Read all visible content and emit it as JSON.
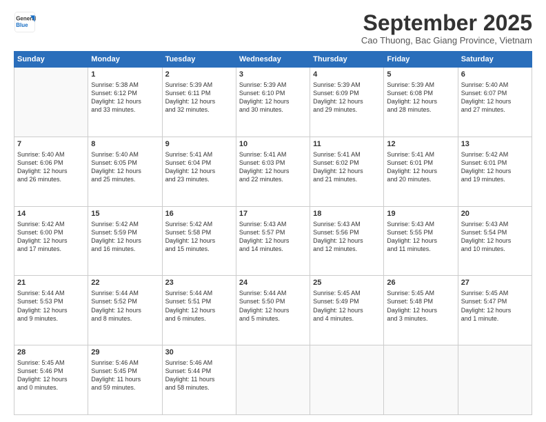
{
  "header": {
    "logo_line1": "General",
    "logo_line2": "Blue",
    "month_title": "September 2025",
    "subtitle": "Cao Thuong, Bac Giang Province, Vietnam"
  },
  "weekdays": [
    "Sunday",
    "Monday",
    "Tuesday",
    "Wednesday",
    "Thursday",
    "Friday",
    "Saturday"
  ],
  "weeks": [
    [
      {
        "day": "",
        "info": ""
      },
      {
        "day": "1",
        "info": "Sunrise: 5:38 AM\nSunset: 6:12 PM\nDaylight: 12 hours\nand 33 minutes."
      },
      {
        "day": "2",
        "info": "Sunrise: 5:39 AM\nSunset: 6:11 PM\nDaylight: 12 hours\nand 32 minutes."
      },
      {
        "day": "3",
        "info": "Sunrise: 5:39 AM\nSunset: 6:10 PM\nDaylight: 12 hours\nand 30 minutes."
      },
      {
        "day": "4",
        "info": "Sunrise: 5:39 AM\nSunset: 6:09 PM\nDaylight: 12 hours\nand 29 minutes."
      },
      {
        "day": "5",
        "info": "Sunrise: 5:39 AM\nSunset: 6:08 PM\nDaylight: 12 hours\nand 28 minutes."
      },
      {
        "day": "6",
        "info": "Sunrise: 5:40 AM\nSunset: 6:07 PM\nDaylight: 12 hours\nand 27 minutes."
      }
    ],
    [
      {
        "day": "7",
        "info": "Sunrise: 5:40 AM\nSunset: 6:06 PM\nDaylight: 12 hours\nand 26 minutes."
      },
      {
        "day": "8",
        "info": "Sunrise: 5:40 AM\nSunset: 6:05 PM\nDaylight: 12 hours\nand 25 minutes."
      },
      {
        "day": "9",
        "info": "Sunrise: 5:41 AM\nSunset: 6:04 PM\nDaylight: 12 hours\nand 23 minutes."
      },
      {
        "day": "10",
        "info": "Sunrise: 5:41 AM\nSunset: 6:03 PM\nDaylight: 12 hours\nand 22 minutes."
      },
      {
        "day": "11",
        "info": "Sunrise: 5:41 AM\nSunset: 6:02 PM\nDaylight: 12 hours\nand 21 minutes."
      },
      {
        "day": "12",
        "info": "Sunrise: 5:41 AM\nSunset: 6:01 PM\nDaylight: 12 hours\nand 20 minutes."
      },
      {
        "day": "13",
        "info": "Sunrise: 5:42 AM\nSunset: 6:01 PM\nDaylight: 12 hours\nand 19 minutes."
      }
    ],
    [
      {
        "day": "14",
        "info": "Sunrise: 5:42 AM\nSunset: 6:00 PM\nDaylight: 12 hours\nand 17 minutes."
      },
      {
        "day": "15",
        "info": "Sunrise: 5:42 AM\nSunset: 5:59 PM\nDaylight: 12 hours\nand 16 minutes."
      },
      {
        "day": "16",
        "info": "Sunrise: 5:42 AM\nSunset: 5:58 PM\nDaylight: 12 hours\nand 15 minutes."
      },
      {
        "day": "17",
        "info": "Sunrise: 5:43 AM\nSunset: 5:57 PM\nDaylight: 12 hours\nand 14 minutes."
      },
      {
        "day": "18",
        "info": "Sunrise: 5:43 AM\nSunset: 5:56 PM\nDaylight: 12 hours\nand 12 minutes."
      },
      {
        "day": "19",
        "info": "Sunrise: 5:43 AM\nSunset: 5:55 PM\nDaylight: 12 hours\nand 11 minutes."
      },
      {
        "day": "20",
        "info": "Sunrise: 5:43 AM\nSunset: 5:54 PM\nDaylight: 12 hours\nand 10 minutes."
      }
    ],
    [
      {
        "day": "21",
        "info": "Sunrise: 5:44 AM\nSunset: 5:53 PM\nDaylight: 12 hours\nand 9 minutes."
      },
      {
        "day": "22",
        "info": "Sunrise: 5:44 AM\nSunset: 5:52 PM\nDaylight: 12 hours\nand 8 minutes."
      },
      {
        "day": "23",
        "info": "Sunrise: 5:44 AM\nSunset: 5:51 PM\nDaylight: 12 hours\nand 6 minutes."
      },
      {
        "day": "24",
        "info": "Sunrise: 5:44 AM\nSunset: 5:50 PM\nDaylight: 12 hours\nand 5 minutes."
      },
      {
        "day": "25",
        "info": "Sunrise: 5:45 AM\nSunset: 5:49 PM\nDaylight: 12 hours\nand 4 minutes."
      },
      {
        "day": "26",
        "info": "Sunrise: 5:45 AM\nSunset: 5:48 PM\nDaylight: 12 hours\nand 3 minutes."
      },
      {
        "day": "27",
        "info": "Sunrise: 5:45 AM\nSunset: 5:47 PM\nDaylight: 12 hours\nand 1 minute."
      }
    ],
    [
      {
        "day": "28",
        "info": "Sunrise: 5:45 AM\nSunset: 5:46 PM\nDaylight: 12 hours\nand 0 minutes."
      },
      {
        "day": "29",
        "info": "Sunrise: 5:46 AM\nSunset: 5:45 PM\nDaylight: 11 hours\nand 59 minutes."
      },
      {
        "day": "30",
        "info": "Sunrise: 5:46 AM\nSunset: 5:44 PM\nDaylight: 11 hours\nand 58 minutes."
      },
      {
        "day": "",
        "info": ""
      },
      {
        "day": "",
        "info": ""
      },
      {
        "day": "",
        "info": ""
      },
      {
        "day": "",
        "info": ""
      }
    ]
  ]
}
